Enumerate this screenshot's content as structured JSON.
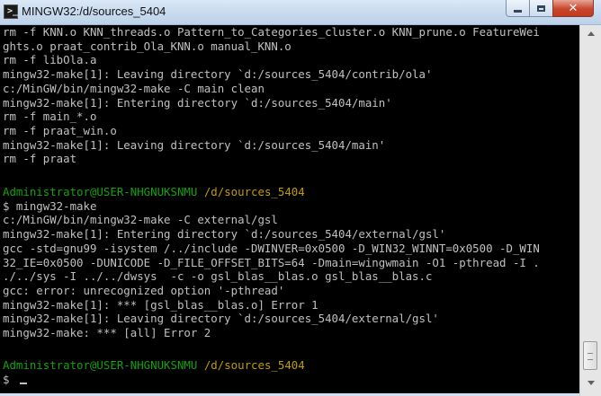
{
  "window": {
    "title": "MINGW32:/d/sources_5404",
    "icon": "terminal-icon"
  },
  "controls": {
    "minimize_icon": "minimize-icon",
    "maximize_icon": "maximize-icon",
    "close_symbol": "✕"
  },
  "colors": {
    "console_bg": "#000000",
    "text": "#c0c0c0",
    "prompt_user": "#13a10e",
    "prompt_path": "#c19c00"
  },
  "terminal": {
    "lines": [
      "rm -f KNN.o KNN_threads.o Pattern_to_Categories_cluster.o KNN_prune.o FeatureWei",
      "ghts.o praat_contrib_Ola_KNN.o manual_KNN.o",
      "rm -f libOla.a",
      "mingw32-make[1]: Leaving directory `d:/sources_5404/contrib/ola'",
      "c:/MinGW/bin/mingw32-make -C main clean",
      "mingw32-make[1]: Entering directory `d:/sources_5404/main'",
      "rm -f main_*.o",
      "rm -f praat_win.o",
      "mingw32-make[1]: Leaving directory `d:/sources_5404/main'",
      "rm -f praat",
      "",
      "Administrator@USER-NHGNUKSNMU /d/sources_5404",
      "$ mingw32-make",
      "c:/MinGW/bin/mingw32-make -C external/gsl",
      "mingw32-make[1]: Entering directory `d:/sources_5404/external/gsl'",
      "gcc -std=gnu99 -isystem /../include -DWINVER=0x0500 -D_WIN32_WINNT=0x0500 -D_WIN",
      "32_IE=0x0500 -DUNICODE -D_FILE_OFFSET_BITS=64 -Dmain=wingwmain -O1 -pthread -I .",
      "./../sys -I ../../dwsys  -c -o gsl_blas__blas.o gsl_blas__blas.c",
      "gcc: error: unrecognized option '-pthread'",
      "mingw32-make[1]: *** [gsl_blas__blas.o] Error 1",
      "mingw32-make[1]: Leaving directory `d:/sources_5404/external/gsl'",
      "mingw32-make: *** [all] Error 2",
      "",
      "Administrator@USER-NHGNUKSNMU /d/sources_5404",
      "$ "
    ],
    "prompt": {
      "user_host": "Administrator@USER-NHGNUKSNMU",
      "path": "/d/sources_5404"
    }
  }
}
